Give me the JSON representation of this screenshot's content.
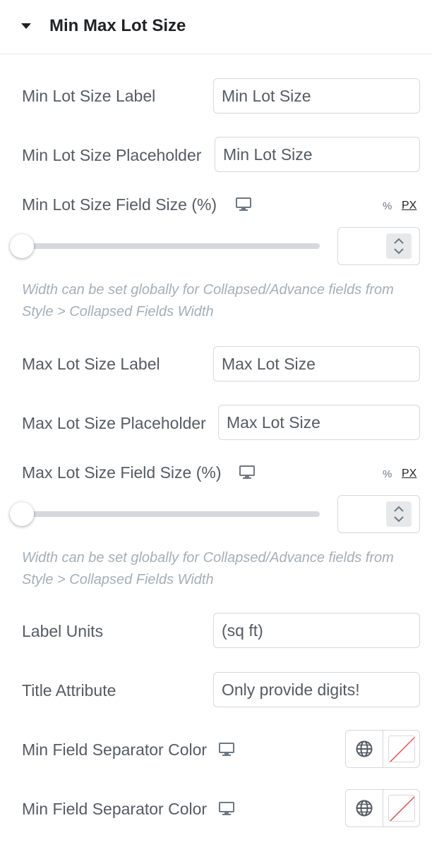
{
  "section": {
    "title": "Min Max Lot Size"
  },
  "fields": {
    "min_label": {
      "label": "Min Lot Size Label",
      "value": "Min Lot Size"
    },
    "min_placeholder": {
      "label": "Min Lot Size Placeholder",
      "value": "Min Lot Size"
    },
    "min_field_size": {
      "label": "Min Lot Size Field Size (%)",
      "unit_percent": "%",
      "unit_px": "PX",
      "value": "",
      "slider_level": 0
    },
    "hint_1": "Width can be set globally for Collapsed/Advance fields from Style > Collapsed Fields Width",
    "max_label": {
      "label": "Max Lot Size Label",
      "value": "Max Lot Size"
    },
    "max_placeholder": {
      "label": "Max Lot Size Placeholder",
      "value": "Max Lot Size"
    },
    "max_field_size": {
      "label": "Max Lot Size Field Size (%)",
      "unit_percent": "%",
      "unit_px": "PX",
      "value": "",
      "slider_level": 0
    },
    "hint_2": "Width can be set globally for Collapsed/Advance fields from Style > Collapsed Fields Width",
    "label_units": {
      "label": "Label Units",
      "value": "(sq ft)"
    },
    "title_attribute": {
      "label": "Title Attribute",
      "value": "Only provide digits!"
    },
    "separator_color_1": {
      "label": "Min Field Separator Color"
    },
    "separator_color_2": {
      "label": "Min Field Separator Color"
    }
  },
  "icons": {
    "caret": "caret-down-icon",
    "device": "desktop-icon",
    "globe": "globe-icon",
    "swatch": "no-color-swatch-icon",
    "spinner": "spinner-arrows-icon"
  },
  "colors": {
    "heading": "#1f2124",
    "text": "#555b63",
    "hint": "#a4afb7",
    "border": "#d5d8dc",
    "swatch_slash": "#e84c4c"
  }
}
